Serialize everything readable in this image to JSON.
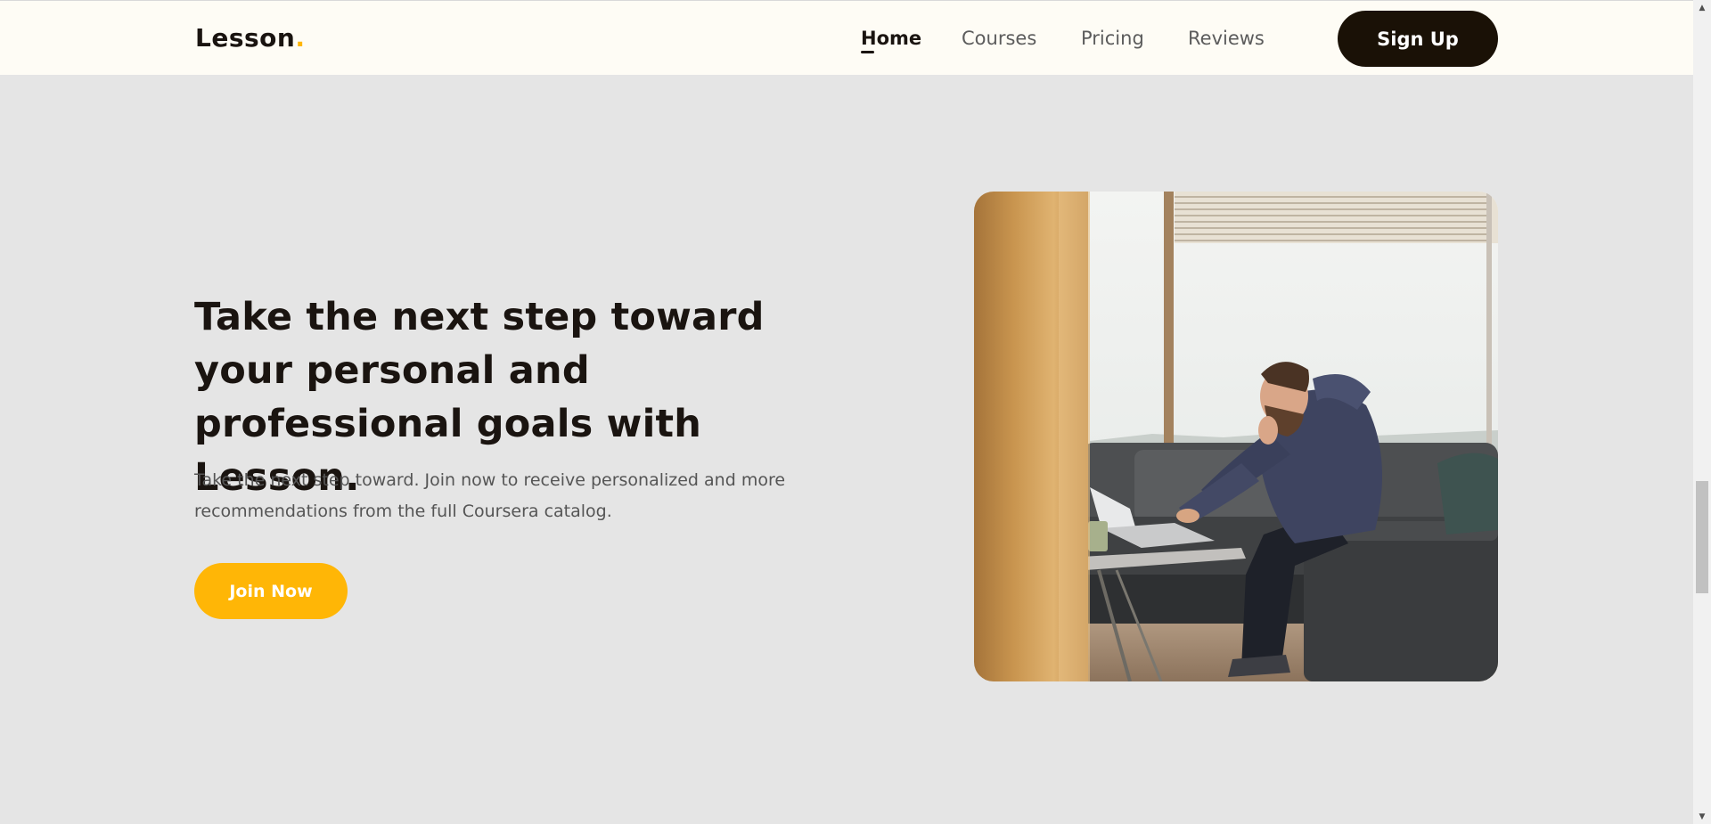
{
  "header": {
    "logo_text": "Lesson",
    "logo_dot": ".",
    "nav": [
      {
        "label": "Home",
        "active": true
      },
      {
        "label": "Courses",
        "active": false
      },
      {
        "label": "Pricing",
        "active": false
      },
      {
        "label": "Reviews",
        "active": false
      }
    ],
    "signup_label": "Sign Up"
  },
  "hero": {
    "title": "Take the next step toward your personal and professional goals with Lesson.",
    "description": "Take the next step toward. Join now to receive personalized and more recommendations from the full Coursera catalog.",
    "cta_label": "Join Now",
    "image_alt": "man working on laptop on a sofa"
  },
  "colors": {
    "accent": "#ffb606",
    "dark": "#1a1106",
    "header_bg": "#fefcf5",
    "page_bg": "#e5e5e5"
  }
}
